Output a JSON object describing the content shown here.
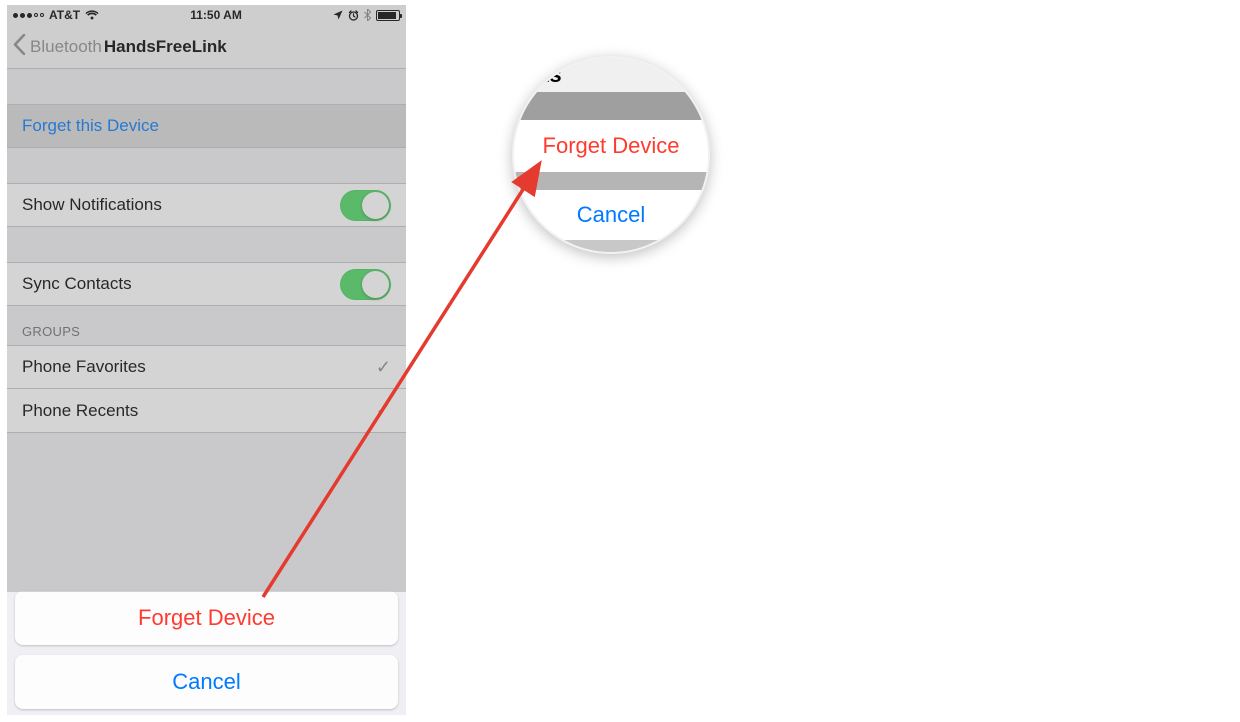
{
  "status": {
    "carrier": "AT&T",
    "time": "11:50 AM"
  },
  "nav": {
    "back_label": "Bluetooth",
    "title": "HandsFreeLink"
  },
  "rows": {
    "forget_this_device": "Forget this Device",
    "show_notifications": "Show Notifications",
    "sync_contacts": "Sync Contacts",
    "groups_label": "GROUPS",
    "phone_favorites": "Phone Favorites",
    "phone_recents": "Phone Recents"
  },
  "sheet": {
    "forget": "Forget Device",
    "cancel": "Cancel"
  },
  "magnifier": {
    "partial_text": "ts",
    "forget": "Forget Device",
    "cancel": "Cancel"
  }
}
